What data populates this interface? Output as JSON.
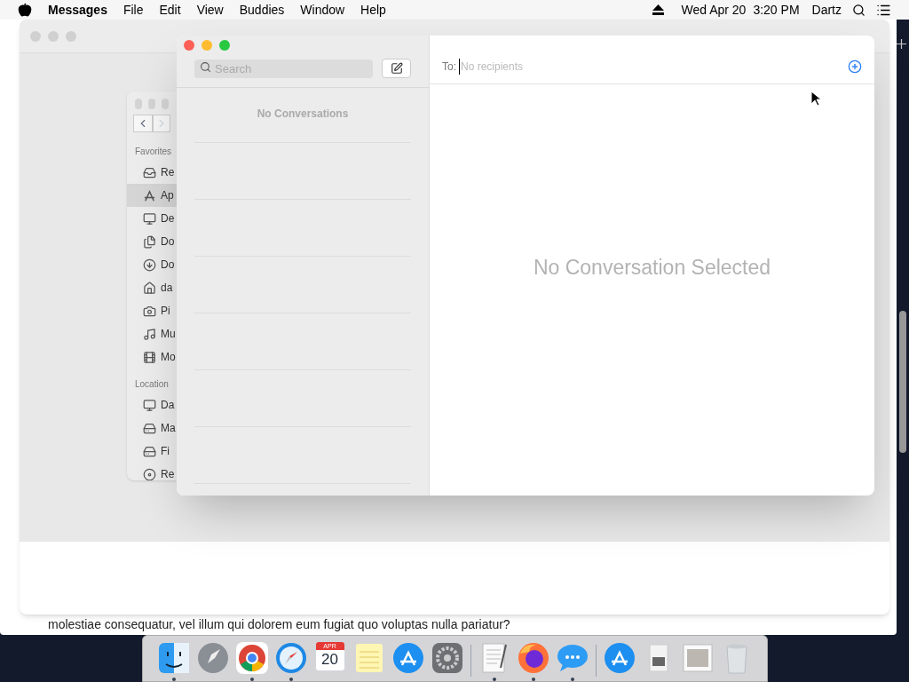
{
  "menubar": {
    "app_name": "Messages",
    "menus": [
      "File",
      "Edit",
      "View",
      "Buddies",
      "Window",
      "Help"
    ],
    "date": "Wed Apr 20",
    "time": "3:20 PM",
    "user": "Dartz"
  },
  "background_window": {
    "text": "molestiae consequatur, vel illum qui dolorem eum fugiat quo voluptas nulla pariatur?"
  },
  "finder": {
    "sections": [
      {
        "title": "Favorites",
        "items": [
          {
            "label": "Re",
            "selected": false
          },
          {
            "label": "Ap",
            "selected": true
          },
          {
            "label": "De",
            "selected": false
          },
          {
            "label": "Do",
            "selected": false
          },
          {
            "label": "Do",
            "selected": false
          },
          {
            "label": "da",
            "selected": false
          },
          {
            "label": "Pi",
            "selected": false
          },
          {
            "label": "Mu",
            "selected": false
          },
          {
            "label": "Mo",
            "selected": false
          }
        ]
      },
      {
        "title": "Location",
        "items": [
          {
            "label": "Da",
            "selected": false
          },
          {
            "label": "Ma",
            "selected": false
          },
          {
            "label": "Fi",
            "selected": false
          },
          {
            "label": "Re",
            "selected": false
          }
        ]
      }
    ]
  },
  "messages": {
    "search_placeholder": "Search",
    "no_conversations": "No Conversations",
    "to_label": "To:",
    "recipients_placeholder": "No recipients",
    "empty_state": "No Conversation Selected"
  },
  "dock": [
    {
      "kind": "finder",
      "running": true
    },
    {
      "kind": "launchpad",
      "running": false
    },
    {
      "kind": "chrome",
      "running": true
    },
    {
      "kind": "safari",
      "running": true
    },
    {
      "kind": "calendar",
      "month": "APR",
      "day": "20",
      "running": false
    },
    {
      "kind": "notes",
      "running": false
    },
    {
      "kind": "appstore",
      "running": false
    },
    {
      "kind": "settings",
      "running": false
    },
    {
      "kind": "divider"
    },
    {
      "kind": "textedit",
      "running": true
    },
    {
      "kind": "firefox",
      "running": true
    },
    {
      "kind": "messages",
      "running": true
    },
    {
      "kind": "divider"
    },
    {
      "kind": "appstore",
      "running": false
    },
    {
      "kind": "disk",
      "running": false
    },
    {
      "kind": "preview",
      "running": false
    },
    {
      "kind": "trash",
      "running": false
    }
  ]
}
